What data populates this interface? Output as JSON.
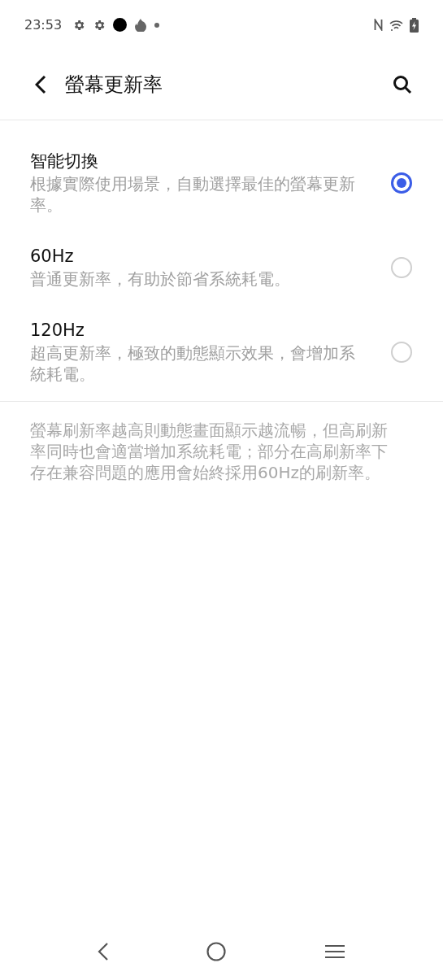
{
  "status_bar": {
    "time": "23:53"
  },
  "header": {
    "title": "螢幕更新率"
  },
  "options": [
    {
      "title": "智能切換",
      "description": "根據實際使用場景，自動選擇最佳的螢幕更新率。",
      "selected": true
    },
    {
      "title": "60Hz",
      "description": "普通更新率，有助於節省系統耗電。",
      "selected": false
    },
    {
      "title": "120Hz",
      "description": "超高更新率，極致的動態顯示效果，會增加系統耗電。",
      "selected": false
    }
  ],
  "footer_note": "螢幕刷新率越高則動態畫面顯示越流暢，但高刷新率同時也會適當增加系統耗電；部分在高刷新率下存在兼容問題的應用會始終採用60Hz的刷新率。"
}
